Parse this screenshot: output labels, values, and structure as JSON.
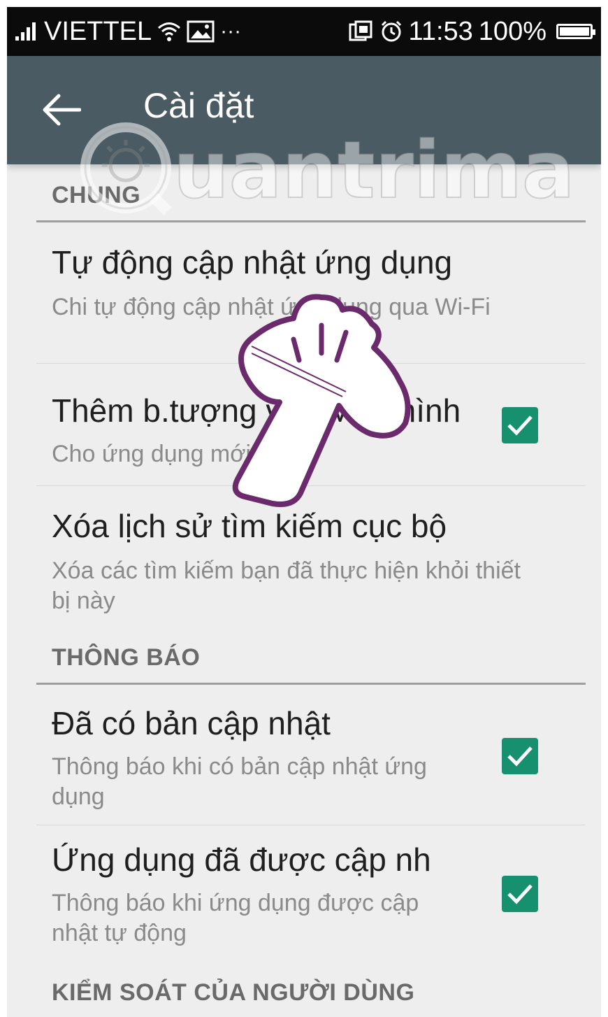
{
  "status_bar": {
    "carrier": "VIETTEL",
    "more": "···",
    "time": "11:53",
    "battery": "100%"
  },
  "app_bar": {
    "title": "Cài đặt",
    "icons": [
      "back-arrow-icon"
    ]
  },
  "watermark": {
    "text": "uantrimang"
  },
  "sections": [
    {
      "header": "CHUNG",
      "items": [
        {
          "title": "Tự động cập nhật ứng dụng",
          "subtitle": "Chi tự động cập nhật ứng dụng qua Wi-Fi",
          "checked": null
        },
        {
          "title": "Thêm b.tượng vào Màn hình",
          "subtitle": "Cho ứng dụng mới",
          "checked": true
        },
        {
          "title": "Xóa lịch sử tìm kiếm cục bộ",
          "subtitle": "Xóa các tìm kiếm bạn đã thực hiện khỏi thiết bị này",
          "checked": null
        }
      ]
    },
    {
      "header": "THÔNG BÁO",
      "items": [
        {
          "title": "Đã có bản cập nhật",
          "subtitle": "Thông báo khi có bản cập nhật ứng dụng",
          "checked": true
        },
        {
          "title": "Ứng dụng đã được cập nh",
          "subtitle": "Thông báo khi ứng dụng được cập nhật tự động",
          "checked": true
        }
      ]
    },
    {
      "header": "KIỂM SOÁT CỦA NGƯỜI DÙNG",
      "items": []
    }
  ],
  "colors": {
    "status_bar": "#0b0b0b",
    "app_bar": "#4a5b63",
    "background": "#eeeeee",
    "checkbox": "#16906e",
    "title_text": "#1f1f1f",
    "subtitle_text": "#8a8a8a",
    "hand_outline": "#6b2a6b"
  },
  "overlay": {
    "icon": "pointing-hand-icon"
  }
}
